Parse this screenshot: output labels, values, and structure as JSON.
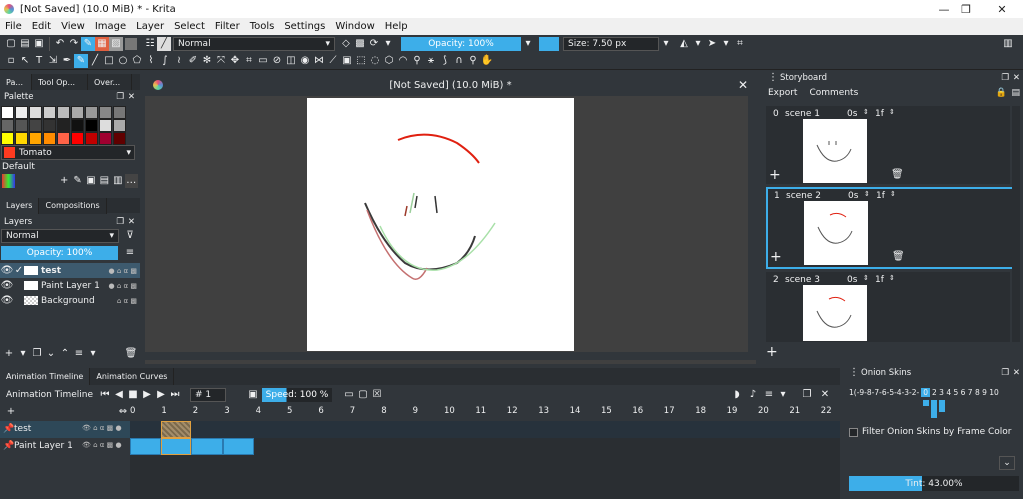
{
  "app": {
    "title": "[Not Saved]  (10.0 MiB) * - Krita",
    "minimize_glyph": "—",
    "maximize_glyph": "❐",
    "close_glyph": "✕"
  },
  "menu": [
    "File",
    "Edit",
    "View",
    "Image",
    "Layer",
    "Select",
    "Filter",
    "Tools",
    "Settings",
    "Window",
    "Help"
  ],
  "toolbar": {
    "blend_mode": "Normal",
    "opacity": "Opacity: 100%",
    "size": "Size: 7.50 px",
    "colors": {
      "accent": "#3daee9",
      "fg_color": "#3daee9",
      "bg_color": "#d8d8d8"
    }
  },
  "left_dock": {
    "top_tabs": [
      "Pa...",
      "Tool Op...",
      "Over..."
    ],
    "palette_title": "Palette",
    "palette_colors": [
      [
        "#ffffff",
        "#eeeeee",
        "#dddddd",
        "#cccccc",
        "#bbbbbb",
        "#aaaaaa",
        "#999999",
        "#888888",
        "#777777"
      ],
      [
        "#666666",
        "#555555",
        "#444444",
        "#333333",
        "#222222",
        "#111111",
        "#000000",
        "#dddddd",
        "#aaaaaa"
      ],
      [
        "#ffff00",
        "#ffd700",
        "#ffa500",
        "#ff8c00",
        "#ff6347",
        "#ff0000",
        "#c00000",
        "#a00030",
        "#600000"
      ]
    ],
    "selected_color_name": "Tomato",
    "selected_color_hex": "#ff3b20",
    "palette_set": "Default",
    "layer_tabs": [
      "Layers",
      "Compositions"
    ],
    "layers_title": "Layers",
    "layer_blend": "Normal",
    "layer_opacity": "Opacity:  100%",
    "layers": [
      {
        "name": "test",
        "active": true
      },
      {
        "name": "Paint Layer 1",
        "active": false
      },
      {
        "name": "Background",
        "active": false
      }
    ]
  },
  "canvas": {
    "title": "[Not Saved]  (10.0 MiB) *",
    "close_glyph": "✕"
  },
  "storyboard": {
    "title": "Storyboard",
    "export_label": "Export",
    "comments_label": "Comments",
    "scenes": [
      {
        "index": "0",
        "name": "scene 1",
        "duration_s": "0s",
        "duration_f": "1f"
      },
      {
        "index": "1",
        "name": "scene 2",
        "duration_s": "0s",
        "duration_f": "1f"
      },
      {
        "index": "2",
        "name": "scene 3",
        "duration_s": "0s",
        "duration_f": "1f"
      }
    ]
  },
  "timeline": {
    "tabs": [
      "Animation Timeline",
      "Animation Curves"
    ],
    "title": "Animation Timeline",
    "frame_field": "# 1",
    "speed": "Speed: 100 %",
    "frame_numbers": [
      "0",
      "1",
      "2",
      "3",
      "4",
      "5",
      "6",
      "7",
      "8",
      "9",
      "10",
      "11",
      "12",
      "13",
      "14",
      "15",
      "16",
      "17",
      "18",
      "19",
      "20",
      "21",
      "22"
    ],
    "tracks": [
      "test",
      "Paint Layer 1"
    ]
  },
  "onion": {
    "title": "Onion Skins",
    "frames_label": "1(-9-8-7-6-5-4-3-2-",
    "center": "0",
    "frames_right": "2 3 4 5 6 7 8 9 10",
    "filter_label": "Filter Onion Skins by Frame Color",
    "tint": "Tint: 43.00%",
    "tint_value": 0.43
  }
}
